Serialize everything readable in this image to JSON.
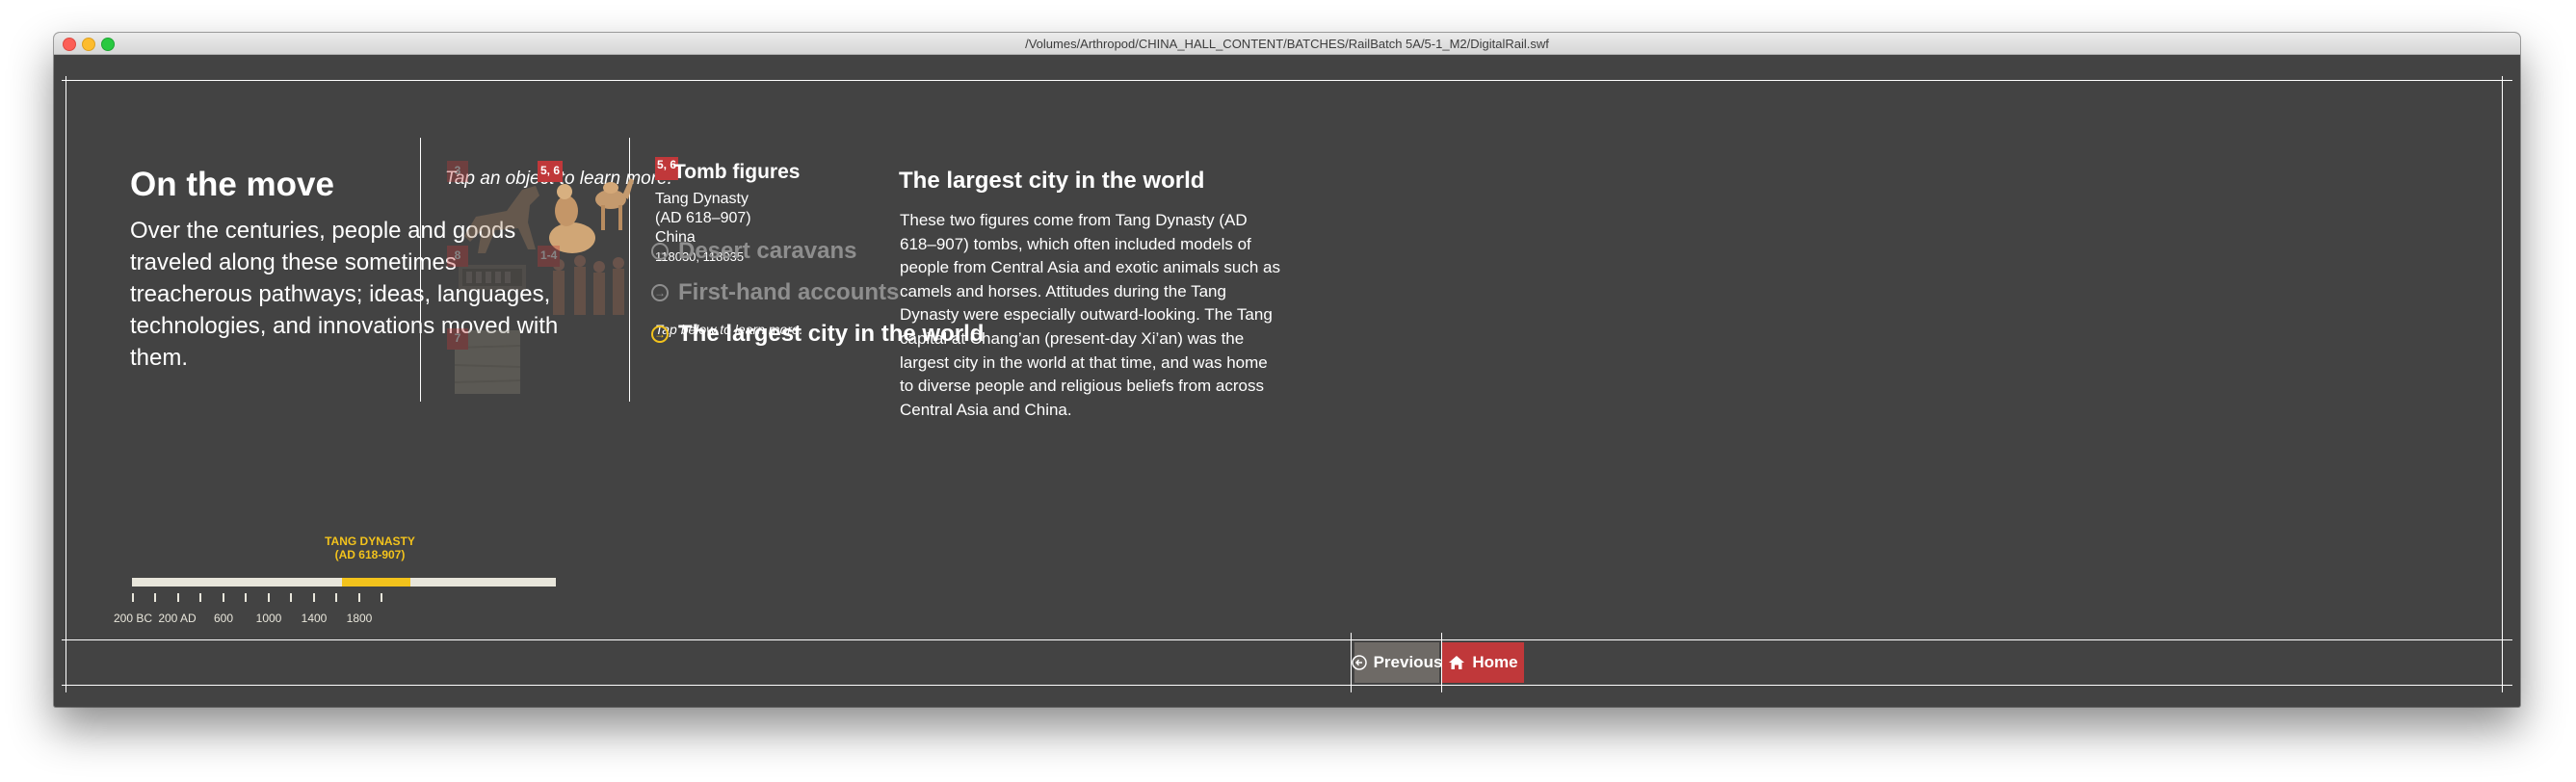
{
  "window": {
    "title": "/Volumes/Arthropod/CHINA_HALL_CONTENT/BATCHES/RailBatch 5A/5-1_M2/DigitalRail.swf"
  },
  "section": {
    "heading": "On the move",
    "intro": "Over the centuries, people and goods traveled along these sometimes treacherous pathways; ideas, languages, technologies, and innovations moved with them."
  },
  "timeline": {
    "label_line1": "TANG DYNASTY",
    "label_line2": "(AD 618-907)",
    "ticks": [
      "200 BC",
      "200 AD",
      "600",
      "1000",
      "1400",
      "1800"
    ],
    "highlight_color": "#f3c31c"
  },
  "gallery": {
    "hint": "Tap an object to learn more.",
    "items": [
      {
        "badge": "3",
        "icon": "horse-figure-icon",
        "selected": false
      },
      {
        "badge": "5, 6",
        "icon": "camel-figures-icon",
        "selected": true
      },
      {
        "badge": "8",
        "icon": "carved-panel-icon",
        "selected": false
      },
      {
        "badge": "1-4",
        "icon": "standing-figures-icon",
        "selected": false
      },
      {
        "badge": "7",
        "icon": "textile-fragment-icon",
        "selected": false
      }
    ]
  },
  "object": {
    "badge": "5, 6",
    "title": "Tomb figures",
    "line1": "Tang Dynasty",
    "line2": "(AD 618–907)",
    "line3": "China",
    "line4": "118030, 118035"
  },
  "topics": {
    "hint": "Tap below to learn more.",
    "items": [
      {
        "label": "Desert caravans",
        "active": false
      },
      {
        "label": "First-hand accounts",
        "active": false
      },
      {
        "label": "The largest city in the world",
        "active": true
      }
    ]
  },
  "detail": {
    "title": "The largest city in the world",
    "body": "These two figures come from Tang Dynasty (AD 618–907) tombs, which often included models of people from Central Asia and exotic animals such as camels and horses. Attitudes during the Tang Dynasty were especially outward-looking. The Tang capital at Chang’an (present-day Xi’an) was the largest city in the world at that time, and was home to diverse people and religious beliefs from across Central Asia and China."
  },
  "nav": {
    "previous_label": "Previous",
    "home_label": "Home"
  },
  "colors": {
    "background": "#434343",
    "accent_red": "#c0383a",
    "accent_yellow": "#f3c31c",
    "inactive_text": "#8e8e8e"
  }
}
